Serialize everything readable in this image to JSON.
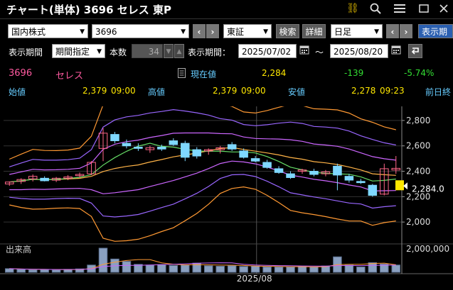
{
  "window": {
    "title": "チャート(単体) 3696 セレス 東P"
  },
  "toolbar": {
    "market": "国内株式",
    "code": "3696",
    "exchange": "東証",
    "search_label": "検索",
    "detail_label": "詳細",
    "period_type": "日足",
    "display_label": "表示期"
  },
  "period_row": {
    "label": "表示期間",
    "mode": "期間指定",
    "count_label": "本数",
    "count_value": "34",
    "range_label": "表示期間：",
    "start": "2025/07/02",
    "tilde": "～",
    "end": "2025/08/20"
  },
  "quote": {
    "code": "3696",
    "name": "セレス",
    "current_label": "現在値",
    "current_value": "2,284",
    "change": "-139",
    "change_pct": "-5.74%",
    "open_label": "始値",
    "open_value": "2,379",
    "open_time": "09:00",
    "high_label": "高値",
    "high_value": "2,379",
    "high_time": "09:00",
    "low_label": "安値",
    "low_value": "2,278",
    "low_time": "09:23",
    "prev_label": "前日終"
  },
  "chart_data": {
    "type": "candlestick",
    "x_axis_label": "2025/08",
    "y_ticks": [
      "2,800",
      "2,600",
      "2,400",
      "2,200",
      "2,000"
    ],
    "ylim": [
      1850,
      2900
    ],
    "current_price_marker": "2,284.0",
    "volume_label": "出来高",
    "volume_tick": "2,000,000",
    "candles": [
      {
        "o": 2300,
        "h": 2320,
        "l": 2285,
        "c": 2315
      },
      {
        "o": 2320,
        "h": 2345,
        "l": 2300,
        "c": 2335
      },
      {
        "o": 2340,
        "h": 2375,
        "l": 2320,
        "c": 2360
      },
      {
        "o": 2345,
        "h": 2360,
        "l": 2320,
        "c": 2325
      },
      {
        "o": 2330,
        "h": 2355,
        "l": 2315,
        "c": 2345
      },
      {
        "o": 2345,
        "h": 2370,
        "l": 2330,
        "c": 2355
      },
      {
        "o": 2365,
        "h": 2390,
        "l": 2350,
        "c": 2375
      },
      {
        "o": 2380,
        "h": 2480,
        "l": 2370,
        "c": 2470
      },
      {
        "o": 2580,
        "h": 2740,
        "l": 2480,
        "c": 2700
      },
      {
        "o": 2690,
        "h": 2710,
        "l": 2620,
        "c": 2640
      },
      {
        "o": 2620,
        "h": 2650,
        "l": 2580,
        "c": 2600
      },
      {
        "o": 2590,
        "h": 2620,
        "l": 2560,
        "c": 2580
      },
      {
        "o": 2570,
        "h": 2600,
        "l": 2545,
        "c": 2585
      },
      {
        "o": 2590,
        "h": 2610,
        "l": 2560,
        "c": 2575
      },
      {
        "o": 2640,
        "h": 2660,
        "l": 2600,
        "c": 2610
      },
      {
        "o": 2620,
        "h": 2640,
        "l": 2480,
        "c": 2510
      },
      {
        "o": 2570,
        "h": 2590,
        "l": 2500,
        "c": 2520
      },
      {
        "o": 2560,
        "h": 2580,
        "l": 2530,
        "c": 2570
      },
      {
        "o": 2570,
        "h": 2600,
        "l": 2540,
        "c": 2585
      },
      {
        "o": 2610,
        "h": 2630,
        "l": 2560,
        "c": 2575
      },
      {
        "o": 2560,
        "h": 2580,
        "l": 2500,
        "c": 2510
      },
      {
        "o": 2500,
        "h": 2520,
        "l": 2470,
        "c": 2480
      },
      {
        "o": 2470,
        "h": 2490,
        "l": 2420,
        "c": 2430
      },
      {
        "o": 2420,
        "h": 2440,
        "l": 2380,
        "c": 2390
      },
      {
        "o": 2380,
        "h": 2400,
        "l": 2340,
        "c": 2350
      },
      {
        "o": 2400,
        "h": 2420,
        "l": 2380,
        "c": 2410
      },
      {
        "o": 2400,
        "h": 2420,
        "l": 2360,
        "c": 2375
      },
      {
        "o": 2380,
        "h": 2410,
        "l": 2360,
        "c": 2395
      },
      {
        "o": 2440,
        "h": 2460,
        "l": 2250,
        "c": 2370
      },
      {
        "o": 2360,
        "h": 2380,
        "l": 2310,
        "c": 2330
      },
      {
        "o": 2320,
        "h": 2340,
        "l": 2300,
        "c": 2310
      },
      {
        "o": 2290,
        "h": 2300,
        "l": 2200,
        "c": 2210
      },
      {
        "o": 2220,
        "h": 2460,
        "l": 2210,
        "c": 2420
      },
      {
        "o": 2410,
        "h": 2520,
        "l": 2380,
        "c": 2423
      }
    ],
    "volume": [
      0.15,
      0.12,
      0.1,
      0.11,
      0.1,
      0.12,
      0.14,
      0.3,
      1.0,
      0.55,
      0.45,
      0.33,
      0.3,
      0.32,
      0.28,
      0.3,
      0.38,
      0.27,
      0.25,
      0.27,
      0.24,
      0.26,
      0.22,
      0.22,
      0.22,
      0.24,
      0.22,
      0.26,
      0.64,
      0.3,
      0.22,
      0.4,
      0.34,
      0.3
    ]
  },
  "colors": {
    "up_candle": "#ff6688",
    "down_candle": "#7fd8ff",
    "price_marker": "#ffe800",
    "ma_short": "#66dd66",
    "ma_mid": "#ffb347",
    "band_orange": "#ff9933",
    "band_purple": "#9966ff",
    "band_pink": "#cc66ff",
    "blue_line": "#6688ff"
  }
}
